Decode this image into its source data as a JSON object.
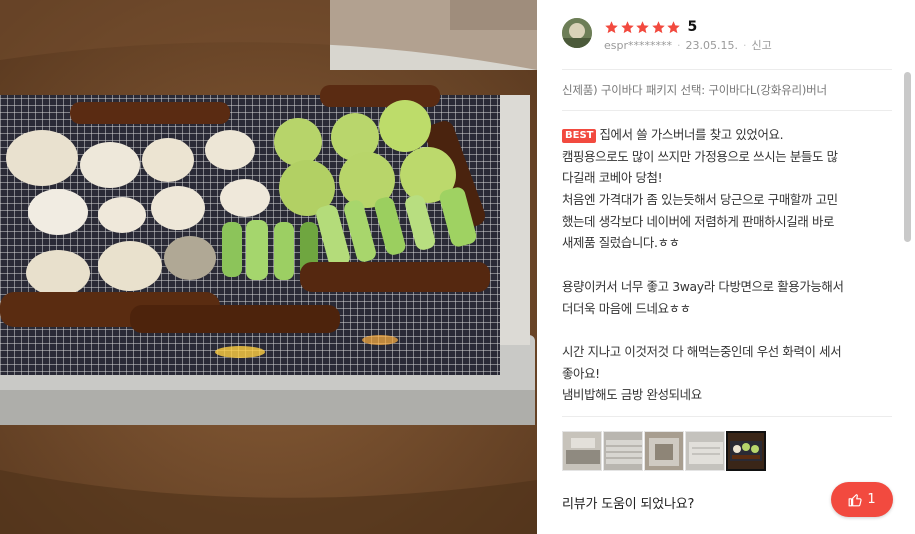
{
  "review": {
    "rating_value": "5",
    "stars_filled": 5,
    "star_color": "#f24a3f",
    "user_id": "espr********",
    "date": "23.05.15.",
    "report_label": "신고",
    "option_text": "신제품) 구이바다 패키지 선택: 구이바다L(강화유리)버너",
    "best_badge": "BEST",
    "body_lines": [
      "집에서 쓸 가스버너를 찾고 있었어요.",
      "캠핑용으로도 많이 쓰지만 가정용으로 쓰시는 분들도 많",
      "다길래 코베아 당첨!",
      "처음엔 가격대가 좀 있는듯해서 당근으로 구매할까 고민",
      "했는데 생각보다 네이버에 저렴하게 판매하시길래 바로",
      "새제품 질렀습니다.ㅎㅎ",
      "",
      "용량이커서 너무 좋고 3way라 다방면으로 활용가능해서",
      "더더욱 마음에 드네요ㅎㅎ",
      "",
      "시간 지나고 이것저것 다 해먹는중인데 우선 화력이 세서",
      "좋아요!",
      "냄비밥해도 금방 완성되네요"
    ],
    "helpful_question": "리뷰가 도움이 되었나요?",
    "like_count": "1",
    "accent_color": "#f24a3f",
    "thumbnail_count": 5,
    "active_thumbnail": 5
  }
}
